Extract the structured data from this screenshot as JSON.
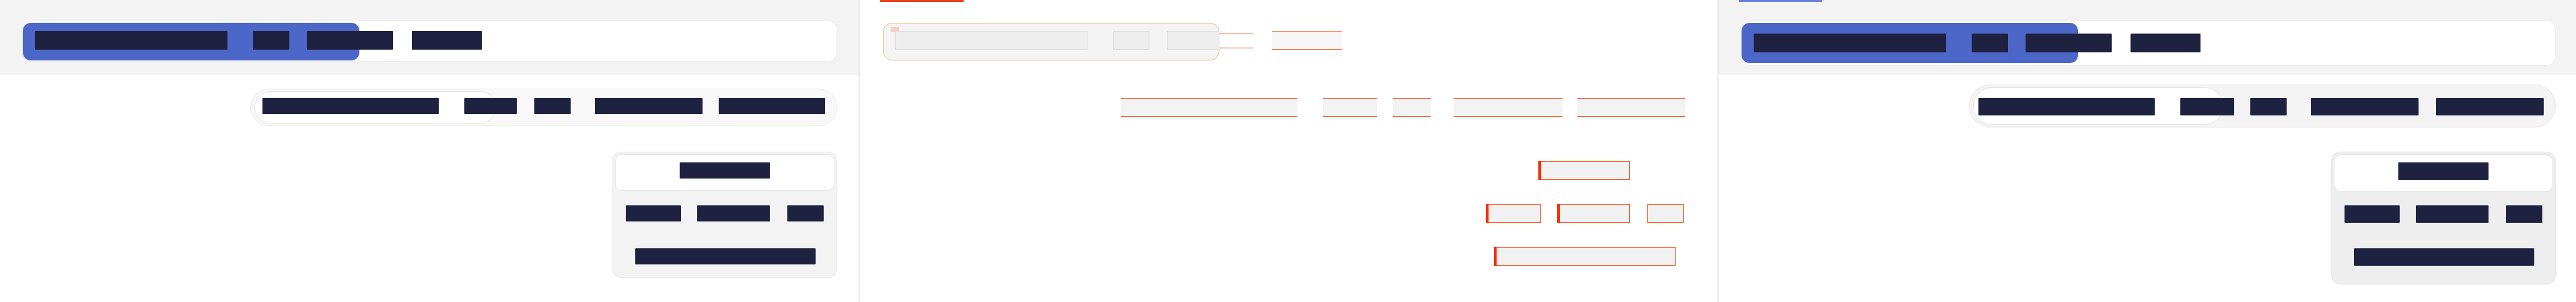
{
  "app": {
    "title": ""
  },
  "left_panel": {
    "segmented_control": {
      "items": [
        "",
        "",
        "",
        "",
        ""
      ]
    },
    "pill_tabs": {
      "items": [
        "",
        "",
        "",
        "",
        ""
      ]
    },
    "dropdown_card": {
      "title": "",
      "options": [
        "",
        "",
        ""
      ],
      "footer": ""
    }
  },
  "middle_panel": {
    "top_items": [
      "",
      "",
      "",
      "",
      ""
    ],
    "tab_items": [
      "",
      "",
      "",
      "",
      ""
    ],
    "card_title": "",
    "card_options": [
      "",
      "",
      ""
    ],
    "card_footer": ""
  },
  "right_panel": {
    "segmented_control": {
      "items": [
        "",
        "",
        "",
        "",
        ""
      ]
    },
    "pill_tabs": {
      "items": [
        "",
        "",
        "",
        "",
        ""
      ]
    },
    "dropdown_card": {
      "title": "",
      "options": [
        "",
        "",
        ""
      ],
      "footer": ""
    }
  },
  "colors": {
    "accent": "#4d67c8",
    "dark_bar": "#1e2140",
    "outline": "#ff5522",
    "soft_outline": "#f0c07a",
    "panel_bg": "#ffffff",
    "strip_bg": "#f3f3f3"
  }
}
